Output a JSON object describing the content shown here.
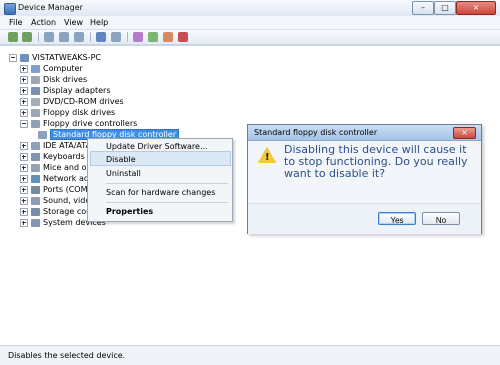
{
  "window": {
    "title": "Device Manager"
  },
  "menu": [
    "File",
    "Action",
    "View",
    "Help"
  ],
  "tree": {
    "root": "VISTATWEAKS-PC",
    "items": [
      "Computer",
      "Disk drives",
      "Display adapters",
      "DVD/CD-ROM drives",
      "Floppy disk drives",
      "Floppy drive controllers",
      "Standard floppy disk controller",
      "IDE ATA/ATA",
      "Keyboards",
      "Mice and oth",
      "Network ada",
      "Ports (COM",
      "Sound, vide",
      "Storage cont",
      "System devices"
    ]
  },
  "context_menu": {
    "items": [
      "Update Driver Software...",
      "Disable",
      "Uninstall",
      "Scan for hardware changes",
      "Properties"
    ]
  },
  "dialog": {
    "title": "Standard floppy disk controller",
    "message": "Disabling this device will cause it to stop functioning. Do you really want to disable it?",
    "yes": "Yes",
    "no": "No"
  },
  "status": "Disables the selected device."
}
